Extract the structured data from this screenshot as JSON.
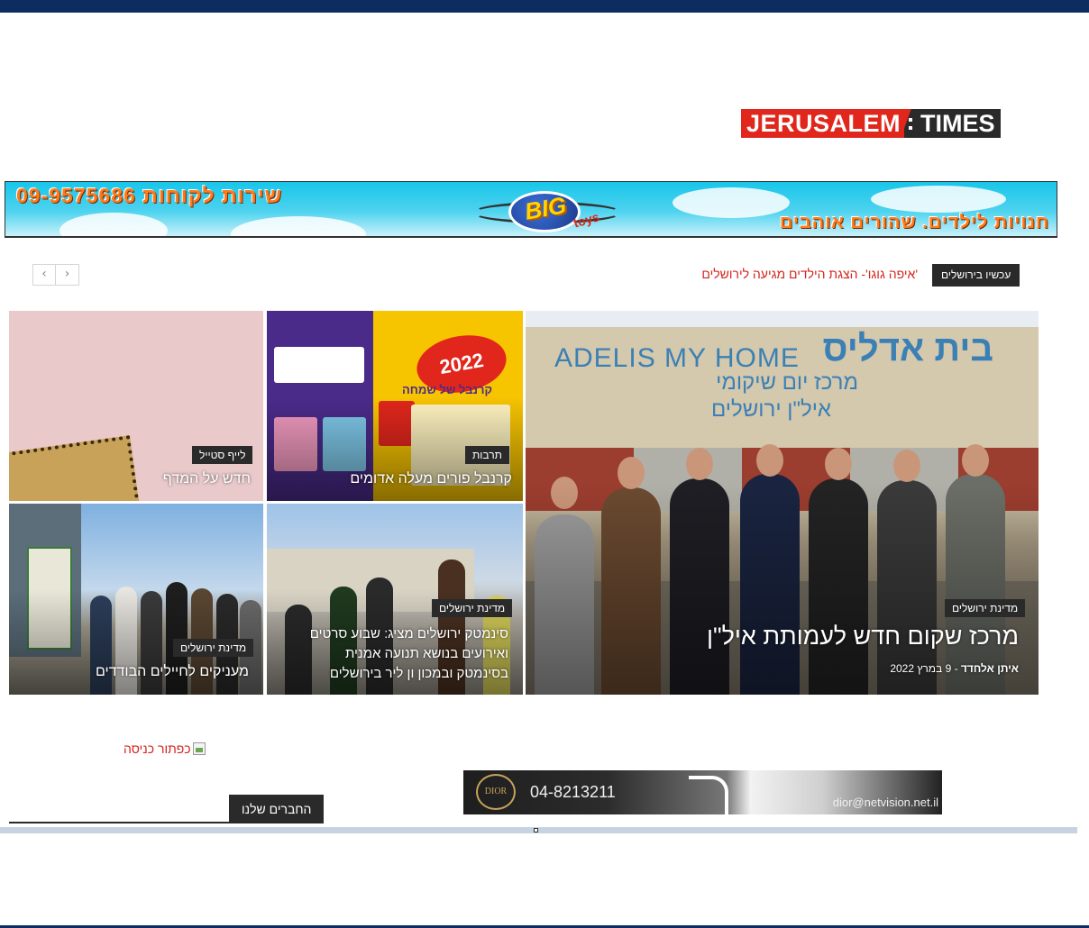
{
  "header": {
    "logo_left": "JERUSALEM",
    "logo_right": "TIMES"
  },
  "banner": {
    "phone_text": "שירות לקוחות 09-9575686",
    "brand": "BIG",
    "brand_sub": "toys",
    "slogan": "חנויות לילדים. שהורים אוהבים"
  },
  "ticker": {
    "badge": "עכשיו בירושלים",
    "headline": "'איפה גוגו'- הצגת הילדים מגיעה לירושלים",
    "prev_icon": "chevron-left-icon",
    "next_icon": "chevron-right-icon",
    "prev_glyph": "‹",
    "next_glyph": "›"
  },
  "grid": {
    "main": {
      "category": "מדינת ירושלים",
      "title": "מרכז שקום חדש לעמותת איל\"ן",
      "author": "איתן אלחדד",
      "date": " - 9 במרץ 2022",
      "sign_en": "ADELIS MY HOME",
      "sign_he1": "בית אדליס",
      "sign_he2": "מרכז יום שיקומי",
      "sign_he3": "איל\"ן ירושלים"
    },
    "purim": {
      "category": "תרבות",
      "title": "קרנבל פורים מעלה אדומים",
      "poster_logo": "2022",
      "poster_sub": "קרנבל של שמחה"
    },
    "lifestyle": {
      "category": "לייף סטייל",
      "title": "חדש על המדף"
    },
    "cinema": {
      "category": "מדינת ירושלים",
      "title_line1": "סינמטק ירושלים מציג: שבוע סרטים",
      "title_line2": "ואירועים בנושא תנועה אמנית",
      "title_line3": "בסינמטק ובמכון ון ליר בירושלים"
    },
    "soldiers": {
      "category": "מדינת ירושלים",
      "title": "מעניקים לחיילים הבודדים"
    }
  },
  "bottom": {
    "broken_image_alt": "כפתור כניסה",
    "partners_label": "החברים שלנו",
    "dior_logo": "DIOR",
    "dior_phone": "04-8213211",
    "dior_email": "dior@netvision.net.il"
  }
}
